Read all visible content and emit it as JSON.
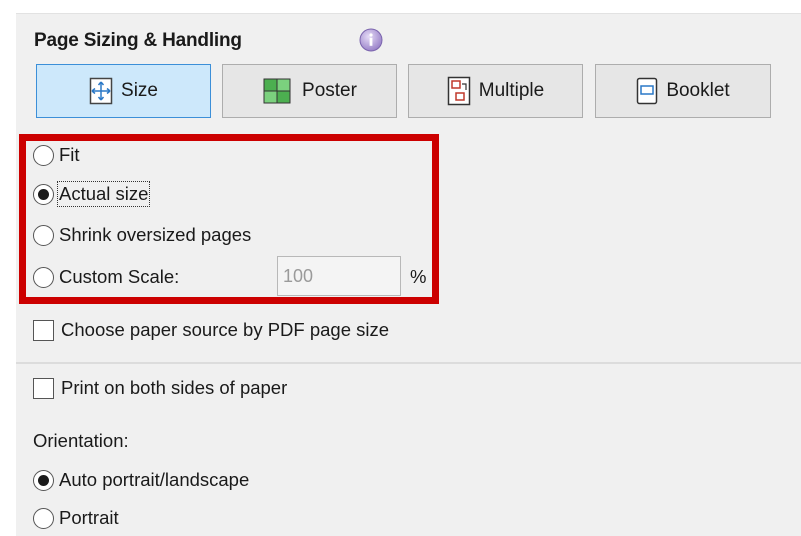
{
  "section": {
    "title": "Page Sizing & Handling",
    "info_icon": "info-icon"
  },
  "modes": [
    {
      "label": "Size",
      "icon": "size-icon",
      "selected": true
    },
    {
      "label": "Poster",
      "icon": "poster-icon",
      "selected": false
    },
    {
      "label": "Multiple",
      "icon": "multiple-icon",
      "selected": false
    },
    {
      "label": "Booklet",
      "icon": "booklet-icon",
      "selected": false
    }
  ],
  "sizing_options": [
    {
      "label": "Fit",
      "selected": false
    },
    {
      "label": "Actual size",
      "selected": true
    },
    {
      "label": "Shrink oversized pages",
      "selected": false
    },
    {
      "label": "Custom Scale:",
      "selected": false
    }
  ],
  "custom_scale": {
    "value": "100",
    "unit": "%"
  },
  "paper_source": {
    "label": "Choose paper source by PDF page size",
    "checked": false
  },
  "duplex": {
    "label": "Print on both sides of paper",
    "checked": false
  },
  "orientation": {
    "label": "Orientation:",
    "options": [
      {
        "label": "Auto portrait/landscape",
        "selected": true
      },
      {
        "label": "Portrait",
        "selected": false
      }
    ]
  },
  "colors": {
    "highlight": "#cc0000",
    "active_button": "#cde8fb",
    "active_border": "#3c8fd8"
  }
}
